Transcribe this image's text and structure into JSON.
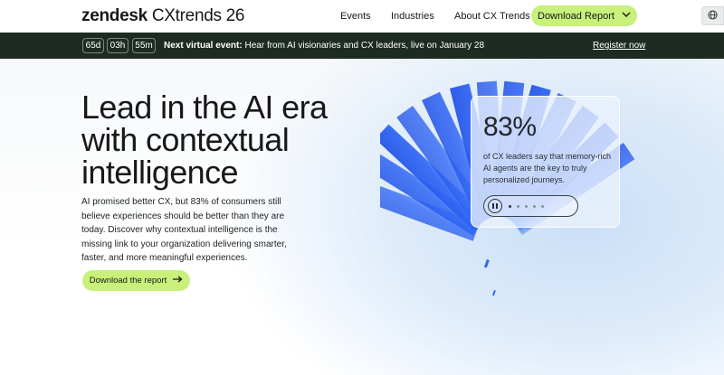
{
  "nav": {
    "logo_brand": "zendesk",
    "logo_product": "CXtrends 26",
    "links": [
      "Events",
      "Industries",
      "About CX Trends"
    ],
    "cta_label": "Download Report",
    "cta_icon": "chevron-down-icon",
    "language_icon": "globe-icon"
  },
  "banner": {
    "countdown": [
      "65d",
      "03h",
      "55m"
    ],
    "event_label": "Next virtual event:",
    "event_text": "Hear from AI visionaries and CX leaders, live on January 28",
    "register_label": "Register now"
  },
  "hero": {
    "headline_lines": [
      "Lead in the AI era",
      "with contextual",
      "intelligence"
    ],
    "lede": "AI promised better CX, but 83% of consumers still believe experiences should be better than they are today. Discover why contextual intelligence is the missing link to your organization delivering smarter, faster, and more meaningful experiences.",
    "cta_label": "Download the report",
    "cta_icon": "arrow-right-icon"
  },
  "stat_card": {
    "value": "83%",
    "caption": "of CX leaders say that memory-rich AI agents are the key to truly personalized journeys.",
    "pause_icon": "pause-icon",
    "slide_count": 5,
    "active_slide": 1
  },
  "colors": {
    "accent_lime": "#c8f07a",
    "banner_bg": "#1e2b22",
    "art_blue": "#2b5ef0"
  }
}
